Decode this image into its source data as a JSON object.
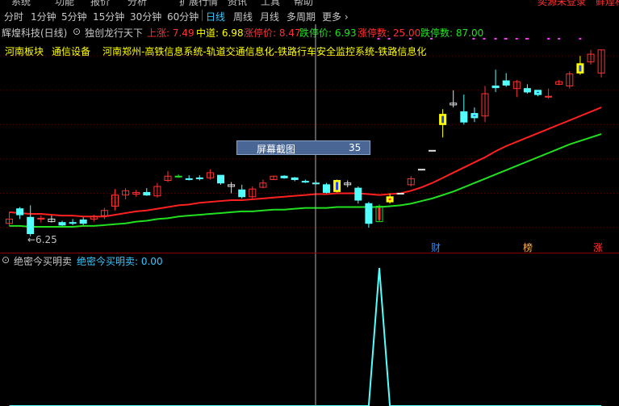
{
  "top_menu": [
    "系统",
    "功能",
    "报价",
    "分析",
    "扩展行情",
    "资讯",
    "工具",
    "帮助"
  ],
  "top_right": [
    "奕源未登录",
    "鲜煌科"
  ],
  "periods": [
    {
      "label": "分时",
      "active": false
    },
    {
      "label": "1分钟",
      "active": false
    },
    {
      "label": "5分钟",
      "active": false
    },
    {
      "label": "15分钟",
      "active": false
    },
    {
      "label": "30分钟",
      "active": false
    },
    {
      "label": "60分钟",
      "active": false
    },
    {
      "label": "日线",
      "active": true
    },
    {
      "label": "周线",
      "active": false
    },
    {
      "label": "月线",
      "active": false
    },
    {
      "label": "多周期",
      "active": false
    },
    {
      "label": "更多",
      "active": false
    }
  ],
  "title_bar": {
    "stock": "辉煌科技(日线)",
    "indicator": "独创龙行天下",
    "shangzhang": "上涨: 7.49",
    "zhongdao": "中道: 6.98",
    "limit_up_price": "涨停价: 8.47",
    "limit_down_price": "跌停价: 6.93",
    "limit_up_count": "涨停数: 25.00",
    "limit_down_count": "跌停数: 87.00"
  },
  "sector_info": {
    "sector": "河南板块",
    "industry": "通信设备",
    "concepts": "河南郑州-高铁信息系统-轨道交通信息化-铁路行车安全监控系统-铁路信息化"
  },
  "screenshot_tip": {
    "label": "屏幕截图",
    "value": "35"
  },
  "low_marker": "←6.25",
  "events": [
    {
      "label": "财",
      "color": "#2a8cff"
    },
    {
      "label": "榜",
      "color": "#ffb040"
    },
    {
      "label": "涨",
      "color": "#ff3030"
    }
  ],
  "indicator_panel": {
    "name": "绝密今买明卖",
    "series_label": "绝密今买明卖: 0.00"
  },
  "colors": {
    "up": "#ff3232",
    "down": "#54ffff",
    "ma_fast": "#ff2020",
    "ma_slow": "#20e020",
    "signal_yellow": "#ffff00",
    "signal_blue": "#2040ff",
    "cursor": "#c0c0c0",
    "indicator_line": "#54ffff"
  },
  "chart_data": {
    "type": "candlestick",
    "candles": [
      {
        "o": 6.5,
        "h": 6.58,
        "l": 6.42,
        "c": 6.45,
        "style": "up"
      },
      {
        "o": 6.62,
        "h": 6.64,
        "l": 6.5,
        "c": 6.55,
        "style": "down"
      },
      {
        "o": 6.52,
        "h": 6.66,
        "l": 6.3,
        "c": 6.33,
        "style": "down"
      },
      {
        "o": 6.5,
        "h": 6.54,
        "l": 6.46,
        "c": 6.51,
        "style": "up"
      },
      {
        "o": 6.5,
        "h": 6.54,
        "l": 6.46,
        "c": 6.47,
        "style": "cross"
      },
      {
        "o": 6.46,
        "h": 6.48,
        "l": 6.42,
        "c": 6.43,
        "style": "blueyellow"
      },
      {
        "o": 6.45,
        "h": 6.5,
        "l": 6.43,
        "c": 6.46,
        "style": "down"
      },
      {
        "o": 6.49,
        "h": 6.52,
        "l": 6.43,
        "c": 6.45,
        "style": "down"
      },
      {
        "o": 6.5,
        "h": 6.55,
        "l": 6.47,
        "c": 6.53,
        "style": "up"
      },
      {
        "o": 6.54,
        "h": 6.63,
        "l": 6.5,
        "c": 6.6,
        "style": "up"
      },
      {
        "o": 6.65,
        "h": 6.85,
        "l": 6.6,
        "c": 6.78,
        "style": "up"
      },
      {
        "o": 6.78,
        "h": 6.86,
        "l": 6.73,
        "c": 6.83,
        "style": "up"
      },
      {
        "o": 6.79,
        "h": 6.84,
        "l": 6.76,
        "c": 6.81,
        "style": "up"
      },
      {
        "o": 6.81,
        "h": 6.86,
        "l": 6.77,
        "c": 6.78,
        "style": "down"
      },
      {
        "o": 6.77,
        "h": 6.92,
        "l": 6.75,
        "c": 6.88,
        "style": "up"
      },
      {
        "o": 6.95,
        "h": 7.06,
        "l": 6.93,
        "c": 7.0,
        "style": "up"
      },
      {
        "o": 7.0,
        "h": 7.02,
        "l": 6.98,
        "c": 6.99,
        "style": "green"
      },
      {
        "o": 6.97,
        "h": 7.01,
        "l": 6.95,
        "c": 6.97,
        "style": "down"
      },
      {
        "o": 6.97,
        "h": 7.01,
        "l": 6.95,
        "c": 6.98,
        "style": "down"
      },
      {
        "o": 6.98,
        "h": 7.08,
        "l": 6.96,
        "c": 7.04,
        "style": "up"
      },
      {
        "o": 7.01,
        "h": 7.01,
        "l": 6.9,
        "c": 6.92,
        "style": "down"
      },
      {
        "o": 6.9,
        "h": 6.93,
        "l": 6.8,
        "c": 6.88,
        "style": "cross"
      },
      {
        "o": 6.84,
        "h": 6.9,
        "l": 6.74,
        "c": 6.76,
        "style": "down"
      },
      {
        "o": 6.76,
        "h": 6.88,
        "l": 6.74,
        "c": 6.85,
        "style": "up"
      },
      {
        "o": 6.87,
        "h": 6.96,
        "l": 6.86,
        "c": 6.92,
        "style": "up"
      },
      {
        "o": 6.96,
        "h": 7.0,
        "l": 6.96,
        "c": 7.0,
        "style": "up"
      },
      {
        "o": 7.0,
        "h": 7.01,
        "l": 6.97,
        "c": 6.98,
        "style": "down"
      },
      {
        "o": 6.98,
        "h": 6.99,
        "l": 6.94,
        "c": 6.96,
        "style": "down"
      },
      {
        "o": 6.94,
        "h": 6.96,
        "l": 6.92,
        "c": 6.93,
        "style": "down"
      },
      {
        "o": 6.92,
        "h": 6.95,
        "l": 6.9,
        "c": 6.91,
        "style": "down"
      },
      {
        "o": 6.9,
        "h": 6.92,
        "l": 6.8,
        "c": 6.81,
        "style": "down"
      },
      {
        "o": 6.82,
        "h": 6.96,
        "l": 6.81,
        "c": 6.95,
        "style": "yellowblue"
      },
      {
        "o": 6.92,
        "h": 6.95,
        "l": 6.87,
        "c": 6.9,
        "style": "cross"
      },
      {
        "o": 6.86,
        "h": 6.88,
        "l": 6.68,
        "c": 6.72,
        "style": "down"
      },
      {
        "o": 6.68,
        "h": 6.7,
        "l": 6.4,
        "c": 6.45,
        "style": "down"
      },
      {
        "o": 6.47,
        "h": 6.67,
        "l": 6.47,
        "c": 6.65,
        "style": "greenred"
      },
      {
        "o": 6.7,
        "h": 6.8,
        "l": 6.68,
        "c": 6.76,
        "style": "yellowred"
      },
      {
        "o": 6.8,
        "h": 6.8,
        "l": 6.8,
        "c": 6.8,
        "style": "cross"
      },
      {
        "o": 6.9,
        "h": 7.0,
        "l": 6.88,
        "c": 6.97,
        "style": "up"
      },
      {
        "o": 7.08,
        "h": 7.08,
        "l": 7.08,
        "c": 7.08,
        "style": "cross"
      },
      {
        "o": 7.3,
        "h": 7.3,
        "l": 7.3,
        "c": 7.3,
        "style": "cross"
      },
      {
        "o": 7.6,
        "h": 7.78,
        "l": 7.45,
        "c": 7.72,
        "style": "yellowblue"
      },
      {
        "o": 7.85,
        "h": 8.0,
        "l": 7.8,
        "c": 7.83,
        "style": "cross"
      },
      {
        "o": 7.63,
        "h": 7.95,
        "l": 7.6,
        "c": 7.75,
        "style": "down"
      },
      {
        "o": 7.73,
        "h": 7.8,
        "l": 7.63,
        "c": 7.68,
        "style": "blueyellow"
      },
      {
        "o": 7.7,
        "h": 8.05,
        "l": 7.63,
        "c": 7.96,
        "style": "up"
      },
      {
        "o": 8.05,
        "h": 8.24,
        "l": 7.98,
        "c": 8.03,
        "style": "down"
      },
      {
        "o": 8.06,
        "h": 8.2,
        "l": 8.04,
        "c": 8.11,
        "style": "down"
      },
      {
        "o": 8.1,
        "h": 8.12,
        "l": 7.92,
        "c": 8.02,
        "style": "up"
      },
      {
        "o": 8.02,
        "h": 8.07,
        "l": 7.96,
        "c": 7.98,
        "style": "down"
      },
      {
        "o": 8.0,
        "h": 8.0,
        "l": 7.93,
        "c": 7.95,
        "style": "blueyellow"
      },
      {
        "o": 7.92,
        "h": 8.02,
        "l": 7.9,
        "c": 7.93,
        "style": "up"
      },
      {
        "o": 8.1,
        "h": 8.12,
        "l": 8.06,
        "c": 8.07,
        "style": "up"
      },
      {
        "o": 8.05,
        "h": 8.22,
        "l": 8.02,
        "c": 8.19,
        "style": "up"
      },
      {
        "o": 8.2,
        "h": 8.4,
        "l": 8.18,
        "c": 8.31,
        "style": "yellowblue"
      },
      {
        "o": 8.33,
        "h": 8.47,
        "l": 8.3,
        "c": 8.42,
        "style": "up"
      },
      {
        "o": 8.2,
        "h": 8.47,
        "l": 8.15,
        "c": 8.47,
        "style": "up"
      }
    ],
    "ma_fast": [
      6.58,
      6.57,
      6.56,
      6.56,
      6.55,
      6.54,
      6.54,
      6.53,
      6.53,
      6.53,
      6.55,
      6.57,
      6.59,
      6.6,
      6.62,
      6.64,
      6.66,
      6.67,
      6.69,
      6.7,
      6.71,
      6.72,
      6.72,
      6.73,
      6.74,
      6.75,
      6.76,
      6.77,
      6.78,
      6.79,
      6.79,
      6.8,
      6.8,
      6.8,
      6.79,
      6.78,
      6.79,
      6.8,
      6.83,
      6.87,
      6.92,
      6.98,
      7.04,
      7.1,
      7.16,
      7.22,
      7.29,
      7.35,
      7.4,
      7.45,
      7.5,
      7.55,
      7.6,
      7.65,
      7.7,
      7.75,
      7.8
    ],
    "ma_slow": [
      6.42,
      6.42,
      6.41,
      6.41,
      6.41,
      6.41,
      6.41,
      6.42,
      6.42,
      6.43,
      6.44,
      6.45,
      6.47,
      6.48,
      6.5,
      6.51,
      6.53,
      6.54,
      6.55,
      6.56,
      6.57,
      6.58,
      6.59,
      6.59,
      6.6,
      6.61,
      6.61,
      6.62,
      6.63,
      6.63,
      6.63,
      6.64,
      6.64,
      6.64,
      6.64,
      6.64,
      6.65,
      6.66,
      6.68,
      6.71,
      6.74,
      6.78,
      6.82,
      6.87,
      6.92,
      6.97,
      7.02,
      7.07,
      7.12,
      7.17,
      7.22,
      7.27,
      7.32,
      7.37,
      7.41,
      7.45,
      7.49
    ],
    "ylim": [
      6.25,
      8.6
    ],
    "low_value": 6.25,
    "indicator_values": [
      0,
      0,
      0,
      0,
      0,
      0,
      0,
      0,
      0,
      0,
      0,
      0,
      0,
      0,
      0,
      0,
      0,
      0,
      0,
      0,
      0,
      0,
      0,
      0,
      0,
      0,
      0,
      0,
      0,
      0,
      0,
      0,
      0,
      0,
      0,
      1,
      0,
      0,
      0,
      0,
      0,
      0,
      0,
      0,
      0,
      0,
      0,
      0,
      0,
      0,
      0,
      0,
      0,
      0,
      0,
      0,
      0
    ]
  }
}
